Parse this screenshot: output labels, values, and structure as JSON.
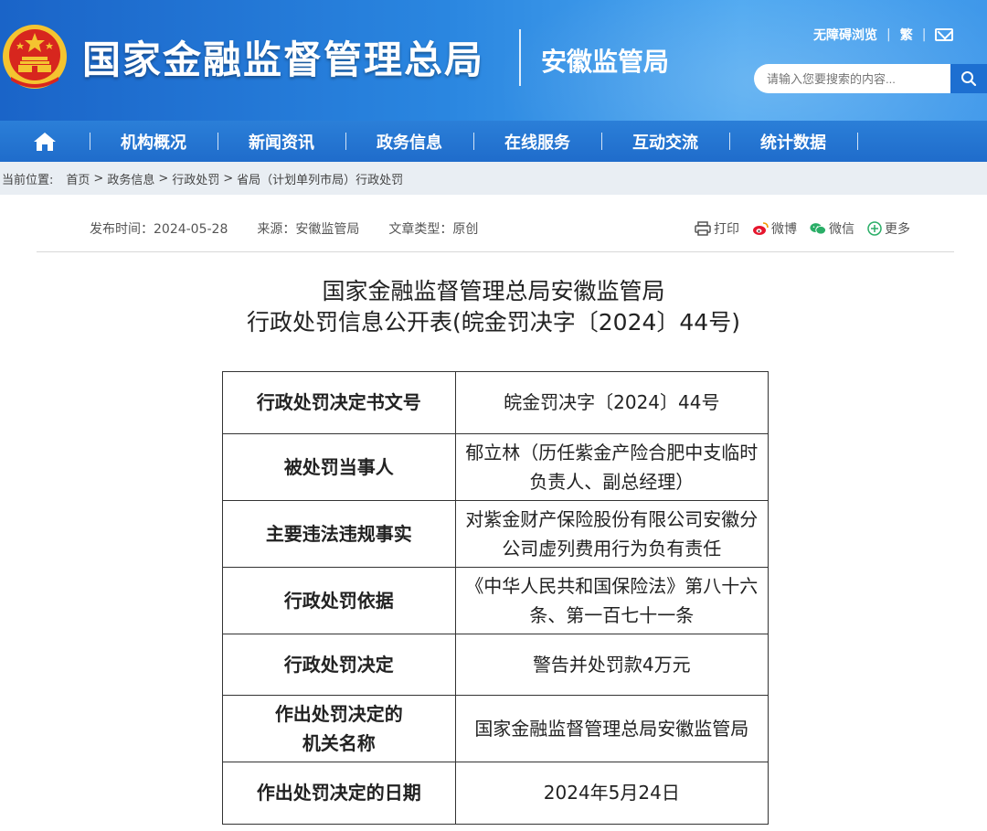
{
  "header": {
    "org_title": "国家金融监督管理总局",
    "branch_title": "安徽监管局",
    "accessibility_link": "无障碍浏览",
    "traditional_link": "繁",
    "search_placeholder": "请输入您要搜索的内容...",
    "colors": {
      "banner": "#2a86e0",
      "emblem_red": "#d7261e",
      "emblem_gold": "#f4c430"
    }
  },
  "nav": {
    "home_icon": "home-icon",
    "items": [
      "机构概况",
      "新闻资讯",
      "政务信息",
      "在线服务",
      "互动交流",
      "统计数据"
    ]
  },
  "breadcrumb": {
    "prefix": "当前位置:",
    "items": [
      "首页",
      "政务信息",
      "行政处罚",
      "省局（计划单列市局）行政处罚"
    ],
    "separator": ">"
  },
  "meta": {
    "publish": "发布时间：2024-05-28",
    "source": "来源：安徽监管局",
    "type": "文章类型：原创"
  },
  "share": {
    "print": "打印",
    "weibo": "微博",
    "wechat": "微信",
    "more": "更多"
  },
  "document": {
    "title_line1": "国家金融监督管理总局安徽监管局",
    "title_line2": "行政处罚信息公开表(皖金罚决字〔2024〕44号)"
  },
  "table": {
    "rows": [
      {
        "label": "行政处罚决定书文号",
        "value": "皖金罚决字〔2024〕44号"
      },
      {
        "label": "被处罚当事人",
        "value": "郁立林（历任紫金产险合肥中支临时负责人、副总经理）"
      },
      {
        "label": "主要违法违规事实",
        "value": "对紫金财产保险股份有限公司安徽分公司虚列费用行为负有责任"
      },
      {
        "label": "行政处罚依据",
        "value": "《中华人民共和国保险法》第八十六条、第一百七十一条"
      },
      {
        "label": "行政处罚决定",
        "value": "警告并处罚款4万元"
      },
      {
        "label": "作出处罚决定的机关名称",
        "value": "国家金融监督管理总局安徽监管局"
      },
      {
        "label": "作出处罚决定的日期",
        "value": "2024年5月24日"
      }
    ]
  }
}
